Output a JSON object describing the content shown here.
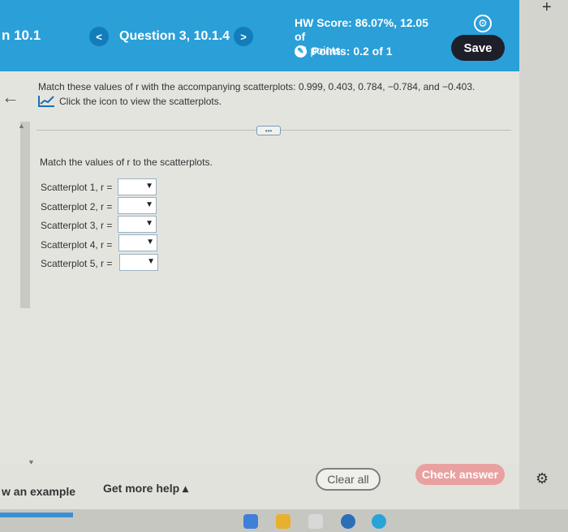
{
  "header": {
    "section_title": "n 10.1",
    "question_title": "Question 3, 10.1.4",
    "prev_glyph": "<",
    "next_glyph": ">",
    "hw_score": "HW Score: 86.07%, 12.05 of",
    "hw_points": "14 points",
    "points_label": "Points: 0.2 of 1",
    "save_label": "Save",
    "icons": [
      "chevron-left-icon",
      "chevron-right-icon",
      "gear-icon",
      "partial-credit-icon"
    ]
  },
  "question": {
    "prompt": "Match these values of r with the accompanying scatterplots: 0.999, 0.403, 0.784, −0.784, and −0.403.",
    "icon_text": "Click the icon to view the scatterplots.",
    "instruction": "Match the values of r to the scatterplots.",
    "rows": [
      {
        "label": "Scatterplot 1, r ="
      },
      {
        "label": "Scatterplot 2, r ="
      },
      {
        "label": "Scatterplot 3, r ="
      },
      {
        "label": "Scatterplot 4, r ="
      },
      {
        "label": "Scatterplot 5, r ="
      }
    ],
    "dropdown_arrow": "▼"
  },
  "footer": {
    "view_example": "w an example",
    "get_more_help": "Get more help ▴",
    "clear_all": "Clear all",
    "check_answer": "Check answer"
  },
  "colors": {
    "header_bg": "#2a9fd8",
    "save_bg": "#1f1f2a",
    "check_answer_bg": "#e9a0a0"
  }
}
